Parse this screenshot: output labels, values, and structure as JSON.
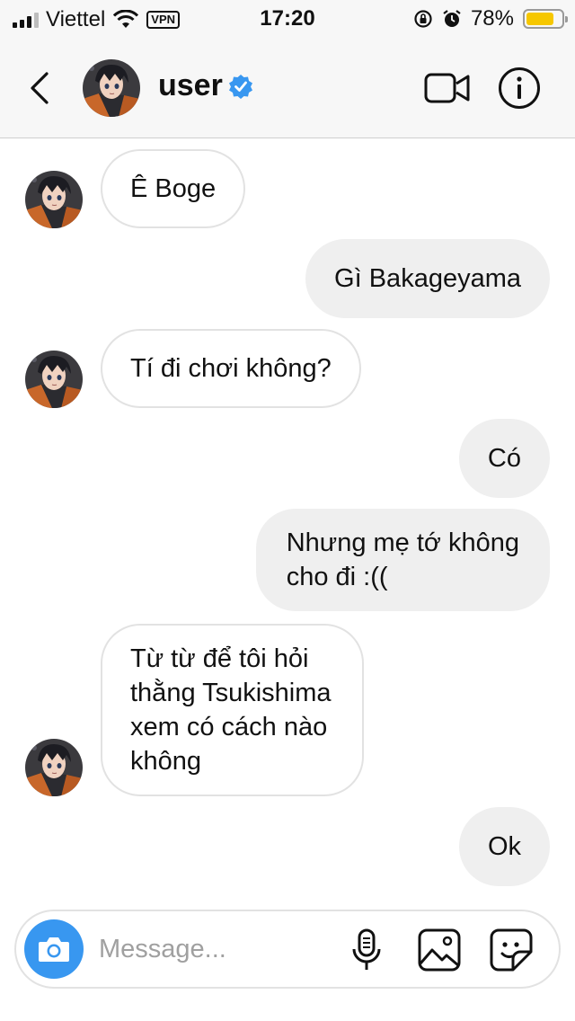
{
  "status_bar": {
    "carrier": "Viettel",
    "vpn": "VPN",
    "time": "17:20",
    "battery_percent": "78%",
    "battery_level": 0.78,
    "battery_color": "#f6c700"
  },
  "header": {
    "username": "user",
    "verified_color": "#3897f0",
    "icons": [
      "back-chevron-icon",
      "video-camera-icon",
      "info-icon",
      "verified-badge-icon"
    ]
  },
  "messages": [
    {
      "side": "in",
      "text": "Ê Boge"
    },
    {
      "side": "out",
      "text": "Gì Bakageyama"
    },
    {
      "side": "in",
      "text": "Tí đi chơi không?"
    },
    {
      "side": "out",
      "text": "Có"
    },
    {
      "side": "out",
      "lines": [
        "Nhưng mẹ tớ không",
        "cho đi :(("
      ]
    },
    {
      "side": "in",
      "lines": [
        "Từ từ để tôi hỏi",
        "thằng Tsukishima",
        "xem có cách nào",
        "không"
      ]
    },
    {
      "side": "out",
      "text": "Ok"
    }
  ],
  "composer": {
    "placeholder": "Message...",
    "accent": "#3897f0",
    "icons": [
      "camera-icon",
      "microphone-icon",
      "photo-gallery-icon",
      "sticker-icon"
    ]
  }
}
